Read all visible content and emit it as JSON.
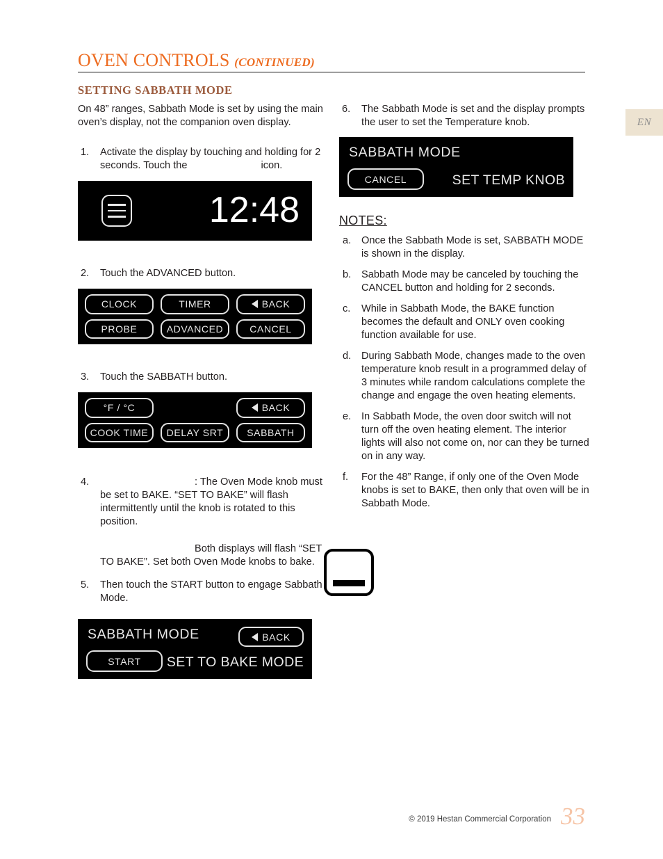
{
  "header": {
    "title_main": "OVEN CONTROLS",
    "title_continued": "(CONTINUED)"
  },
  "language_tab": {
    "label": "EN"
  },
  "left_column": {
    "section_heading": "SETTING SABBATH MODE",
    "intro": "On 48” ranges, Sabbath Mode is set by using the main oven’s display, not the companion oven display.",
    "steps": [
      {
        "number": "1.",
        "text_before": "Activate the display by touching and holding for 2 seconds.  Touch the",
        "text_after": "icon."
      },
      {
        "number": "2.",
        "text": "Touch the ADVANCED button."
      },
      {
        "number": "3.",
        "text": "Touch the SABBATH button."
      },
      {
        "number": "4.",
        "text_after_gap": ": The Oven Mode knob must be set to BAKE.  “SET TO BAKE” will flash intermittently until the knob is rotated to this position.",
        "text_second_after_gap": "Both displays will flash “SET TO BAKE”.  Set both Oven Mode knobs to bake."
      },
      {
        "number": "5.",
        "text": "Then touch the START button to engage Sabbath Mode."
      }
    ],
    "clock_display": {
      "menu_icon": "hamburger-menu-icon",
      "time": "12:48"
    },
    "advanced_keypad": {
      "buttons": [
        "CLOCK",
        "TIMER",
        "BACK",
        "PROBE",
        "ADVANCED",
        "CANCEL"
      ],
      "back_label": "BACK",
      "back_arrow_icon": "triangle-left-icon"
    },
    "sabbath_keypad": {
      "buttons": [
        "°F / °C",
        "",
        "BACK",
        "COOK TIME",
        "DELAY SRT",
        "SABBATH"
      ],
      "back_label": "BACK",
      "back_arrow_icon": "triangle-left-icon"
    },
    "sabbath_start_display": {
      "title": "SABBATH MODE",
      "back_label": "BACK",
      "start_label": "START",
      "message": "SET TO BAKE MODE"
    }
  },
  "right_column": {
    "step6": {
      "number": "6.",
      "text": "The Sabbath Mode is set and the display prompts the user to set the Temperature knob."
    },
    "sabbath_temp_display": {
      "title": "SABBATH MODE",
      "cancel_label": "CANCEL",
      "message": "SET TEMP KNOB"
    },
    "notes_heading": "NOTES:",
    "notes": [
      {
        "mark": "a.",
        "text": "Once the Sabbath Mode is set, SABBATH MODE is shown in the display."
      },
      {
        "mark": "b.",
        "text": "Sabbath Mode may be canceled by touching the CANCEL button and holding for 2 seconds."
      },
      {
        "mark": "c.",
        "text": "While in Sabbath Mode, the BAKE function becomes the default and ONLY oven cooking function available for use."
      },
      {
        "mark": "d.",
        "text": "During Sabbath Mode, changes made to the oven temperature knob result in a programmed delay of 3 minutes while random calculations complete the change and engage the oven heating elements."
      },
      {
        "mark": "e.",
        "text": "In Sabbath Mode, the oven door switch will not turn off the oven heating element.  The interior lights will also not come on, nor can they be turned on in any way."
      },
      {
        "mark": "f.",
        "text": "For the 48” Range, if only one of the Oven Mode knobs is set to BAKE, then only that oven will be in Sabbath Mode."
      }
    ]
  },
  "footer": {
    "copyright": "© 2019 Hestan Commercial Corporation",
    "page_number": "33"
  },
  "colors": {
    "title_orange": "#ED6C21",
    "section_brown": "#9B5A3C",
    "tab_beige": "#EDE3D1",
    "page_number_peach": "#F6C4A6",
    "lcd_black": "#000000"
  }
}
